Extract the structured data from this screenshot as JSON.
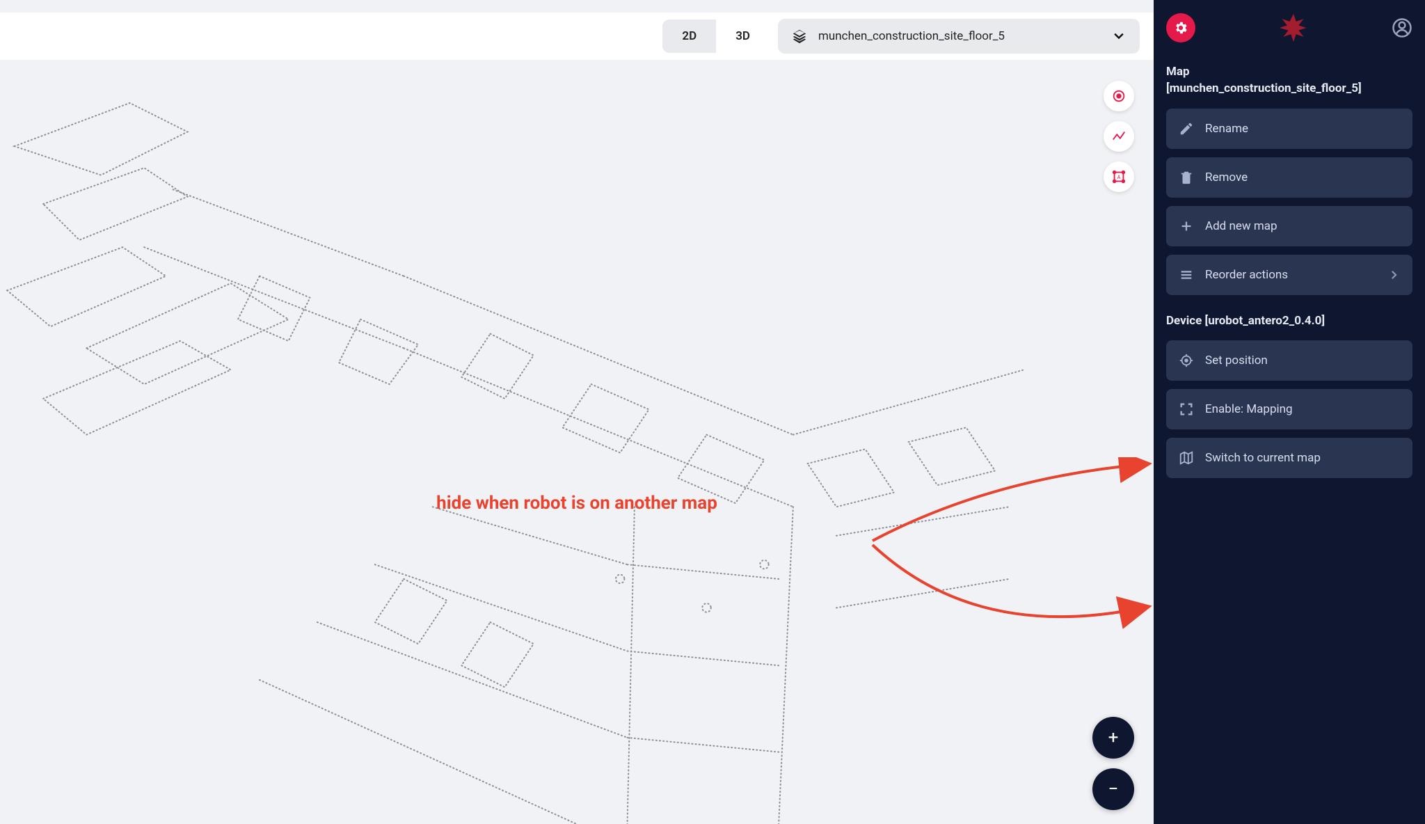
{
  "topbar": {
    "view2d": "2D",
    "view3d": "3D",
    "active_view": "2D",
    "map_selected": "munchen_construction_site_floor_5"
  },
  "annotation": {
    "text": "hide when robot is on another map"
  },
  "zoom": {
    "in": "+",
    "out": "−"
  },
  "sidebar": {
    "map_section": {
      "title_line1": "Map",
      "title_line2": "[munchen_construction_site_floor_5]",
      "rename": "Rename",
      "remove": "Remove",
      "add_new_map": "Add new map",
      "reorder_actions": "Reorder actions"
    },
    "device_section": {
      "title": "Device [urobot_antero2_0.4.0]",
      "set_position": "Set position",
      "enable_mapping": "Enable: Mapping",
      "switch_map": "Switch to current map"
    }
  }
}
